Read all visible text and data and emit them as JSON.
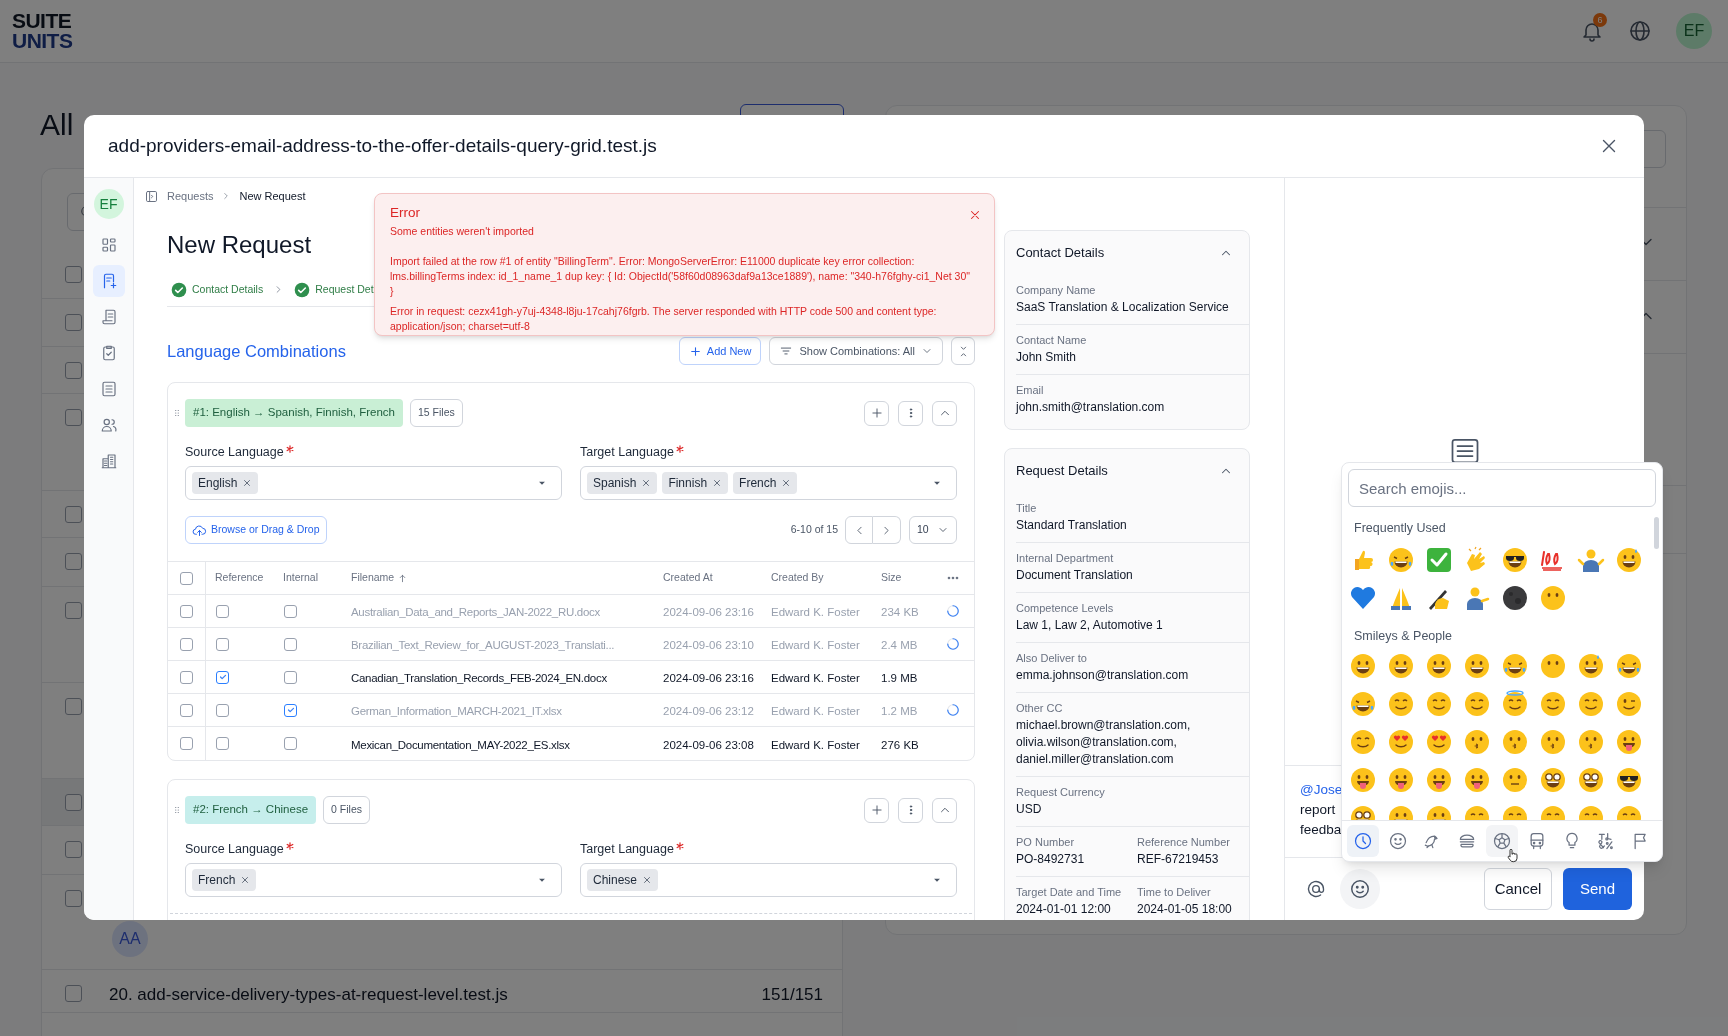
{
  "app_header": {
    "logo_top": "SUITE",
    "logo_bottom": "UNITS",
    "notification_count": "6",
    "avatar": "EF"
  },
  "background": {
    "heading": "All",
    "checkboxes": [
      {
        "checked": false
      },
      {
        "checked": false
      },
      {
        "checked": false
      },
      {
        "checked": false
      },
      {
        "checked": false
      },
      {
        "checked": false
      },
      {
        "checked": false
      },
      {
        "checked": false
      },
      {
        "checked": false
      },
      {
        "checked": false
      },
      {
        "checked": false
      },
      {
        "checked": false
      }
    ],
    "avatar": "AA",
    "row": {
      "title": "20. add-service-delivery-types-at-request-level.test.js",
      "count": "151/151"
    }
  },
  "modal": {
    "title": "add-providers-email-address-to-the-offer-details-query-grid.test.js"
  },
  "sidebar": {
    "avatar": "EF",
    "items": [
      {
        "kind": "dashboard",
        "selected": false
      },
      {
        "kind": "new-request",
        "selected": true
      },
      {
        "kind": "document",
        "selected": false
      },
      {
        "kind": "tasks",
        "selected": false
      },
      {
        "kind": "list",
        "selected": false
      },
      {
        "kind": "users",
        "selected": false
      },
      {
        "kind": "buildings",
        "selected": false
      }
    ]
  },
  "breadcrumb": [
    "Requests",
    "New Request"
  ],
  "page_title": "New Request",
  "steps": [
    {
      "label": "Contact Details",
      "done": true
    },
    {
      "label": "Request Det",
      "done": true
    }
  ],
  "error_toast": {
    "title": "Error",
    "subtitle": "Some entities weren't imported",
    "messages": [
      "Import failed at the row #1 of entity \"BillingTerm\". Error: MongoServerError: E11000 duplicate key error collection: lms.billingTerms index: id_1_name_1 dup key: { Id: ObjectId('58f60d08963daf9a13ce1889'), name: \"340-h76fghy-ci1_Net 30\" }",
      "Error in request: cezx41gh-y7uj-4348-l8ju-17cahj76fgrb. The server responded with HTTP code 500 and content type: application/json; charset=utf-8"
    ]
  },
  "language_combinations": {
    "title": "Language Combinations",
    "add_button": "Add New",
    "filter_button": "Show Combinations: All",
    "combinations": [
      {
        "label": "#1: English → Spanish, Finnish, French",
        "color": "#c9efd5",
        "files": "15 Files",
        "source_label": "Source Language",
        "source": [
          "English"
        ],
        "target_label": "Target Language",
        "target": [
          "Spanish",
          "Finnish",
          "French"
        ],
        "upload_button": "Browse or Drag & Drop",
        "pagination": {
          "range": "6-10 of 15",
          "page_size": "10"
        },
        "table": {
          "all_selected": false,
          "columns": [
            {
              "label": "Reference",
              "sorted": false
            },
            {
              "label": "Internal",
              "sorted": false
            },
            {
              "label": "Filename",
              "sorted": true
            },
            {
              "label": "Created At",
              "sorted": false
            },
            {
              "label": "Created By",
              "sorted": false
            },
            {
              "label": "Size",
              "sorted": false
            }
          ],
          "rows": [
            {
              "selected": false,
              "reference": false,
              "internal": false,
              "filename": "Australian_Data_and_Reports_JAN-2022_RU.docx",
              "created_at": "2024-09-06 23:16",
              "created_by": "Edward K. Foster",
              "size": "234 KB",
              "uploading": true
            },
            {
              "selected": false,
              "reference": false,
              "internal": false,
              "filename": "Brazilian_Text_Review_for_AUGUST-2023_Translati...",
              "created_at": "2024-09-06 23:10",
              "created_by": "Edward K. Foster",
              "size": "2.4 MB",
              "uploading": true
            },
            {
              "selected": false,
              "reference": true,
              "internal": false,
              "filename": "Canadian_Translation_Records_FEB-2024_EN.docx",
              "created_at": "2024-09-06 23:16",
              "created_by": "Edward K. Foster",
              "size": "1.9 MB",
              "uploading": false
            },
            {
              "selected": false,
              "reference": false,
              "internal": true,
              "filename": "German_Information_MARCH-2021_IT.xlsx",
              "created_at": "2024-09-06 23:12",
              "created_by": "Edward K. Foster",
              "size": "1.2 MB",
              "uploading": true
            },
            {
              "selected": false,
              "reference": false,
              "internal": false,
              "filename": "Mexican_Documentation_MAY-2022_ES.xlsx",
              "created_at": "2024-09-06 23:08",
              "created_by": "Edward K. Foster",
              "size": "276 KB",
              "uploading": false
            }
          ]
        }
      },
      {
        "label": "#2: French → Chinese",
        "color": "#c6eeec",
        "files": "0 Files",
        "source_label": "Source Language",
        "source": [
          "French"
        ],
        "target_label": "Target Language",
        "target": [
          "Chinese"
        ]
      }
    ]
  },
  "details": [
    {
      "title": "Contact Details",
      "expanded": true,
      "rows": [
        [
          {
            "label": "Company Name",
            "value": "SaaS Translation & Localization Service"
          }
        ],
        [
          {
            "label": "Contact Name",
            "value": "John Smith"
          }
        ],
        [
          {
            "label": "Email",
            "value": "john.smith@translation.com"
          }
        ]
      ]
    },
    {
      "title": "Request Details",
      "expanded": true,
      "rows": [
        [
          {
            "label": "Title",
            "value": "Standard Translation"
          }
        ],
        [
          {
            "label": "Internal Department",
            "value": "Document Translation"
          }
        ],
        [
          {
            "label": "Competence Levels",
            "value": "Law 1, Law 2, Automotive 1"
          }
        ],
        [
          {
            "label": "Also Deliver to",
            "value": "emma.johnson@translation.com"
          }
        ],
        [
          {
            "label": "Other CC",
            "value": "michael.brown@translation.com, olivia.wilson@translation.com, daniel.miller@translation.com"
          }
        ],
        [
          {
            "label": "Request Currency",
            "value": "USD"
          }
        ],
        [
          {
            "label": "PO Number",
            "value": "PO-8492731"
          },
          {
            "label": "Reference Number",
            "value": "REF-67219453"
          }
        ],
        [
          {
            "label": "Target Date and Time",
            "value": "2024-01-01 12:00"
          },
          {
            "label": "Time to Deliver",
            "value": "2024-01-05 18:00"
          }
        ]
      ]
    }
  ],
  "comment": {
    "mention": "@Jose",
    "lines": [
      "report",
      "feedba"
    ],
    "cancel": "Cancel",
    "send": "Send"
  },
  "emoji_picker": {
    "placeholder": "Search emojis...",
    "sections": [
      {
        "title": "Frequently Used"
      },
      {
        "title": "Smileys & People"
      }
    ],
    "category_tabs": [
      {
        "kind": "recent",
        "selected": true,
        "hovered": false
      },
      {
        "kind": "smileys",
        "selected": false,
        "hovered": false
      },
      {
        "kind": "animals",
        "selected": false,
        "hovered": false
      },
      {
        "kind": "food",
        "selected": false,
        "hovered": false
      },
      {
        "kind": "activity",
        "selected": false,
        "hovered": true
      },
      {
        "kind": "travel",
        "selected": false,
        "hovered": false
      },
      {
        "kind": "objects",
        "selected": false,
        "hovered": false
      },
      {
        "kind": "symbols",
        "selected": false,
        "hovered": false
      },
      {
        "kind": "flags",
        "selected": false,
        "hovered": false
      }
    ]
  }
}
